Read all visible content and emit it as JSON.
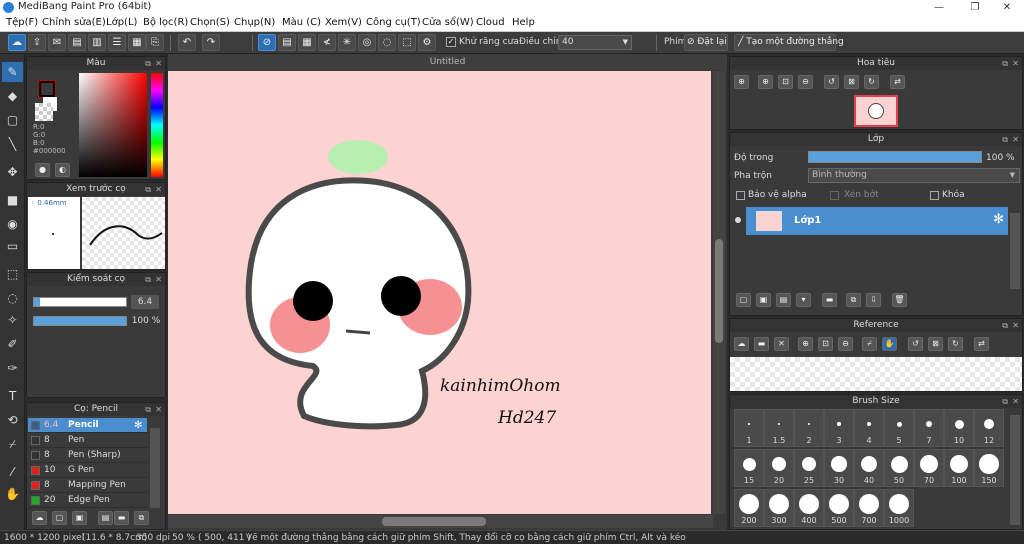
{
  "app": {
    "title": "MediBang Paint Pro (64bit)"
  },
  "menu": [
    "Tệp(F)",
    "Chỉnh sửa(E)",
    "Lớp(L)",
    "Bộ lọc(R)",
    "Chọn(S)",
    "Chụp(N)",
    "Màu (C)",
    "Xem(V)",
    "Công cụ(T)",
    "Cửa sổ(W)",
    "Cloud",
    "Help"
  ],
  "toolbar": {
    "antialias_label": "Khử răng cưa",
    "adjust_label": "Điều chỉnh",
    "adjust_value": "40",
    "pen_label": "Phím",
    "reset_label": "Đặt lại",
    "ruler_label": "Tạo một đường thẳng"
  },
  "color_panel": {
    "title": "Màu",
    "r": "R:0",
    "g": "G:0",
    "b": "B:0",
    "hex": "#000000",
    "fg": "#cc0000",
    "bg": "#ffffff"
  },
  "preview_panel": {
    "title": "Xem trước cọ",
    "size": "0.46mm"
  },
  "brush_control": {
    "title": "Kiểm soát cọ",
    "size_value": "6.4",
    "opacity_value": "100 %",
    "size_fraction": 0.07,
    "opacity_fraction": 1.0
  },
  "brush_panel": {
    "title": "Cọ: Pencil",
    "items": [
      {
        "size": "6.4",
        "name": "Pencil",
        "color": "#3a5f8a"
      },
      {
        "size": "8",
        "name": "Pen",
        "color": "#333333"
      },
      {
        "size": "8",
        "name": "Pen (Sharp)",
        "color": "#333333"
      },
      {
        "size": "10",
        "name": "G Pen",
        "color": "#dd2222"
      },
      {
        "size": "8",
        "name": "Mapping Pen",
        "color": "#dd2222"
      },
      {
        "size": "20",
        "name": "Edge Pen",
        "color": "#22aa22"
      }
    ]
  },
  "canvas": {
    "tab": "Untitled",
    "bg": "#fdd3d1",
    "signature_line1": "kainhimOhom",
    "signature_line2": "Hd247"
  },
  "navigator": {
    "title": "Hoa tiêu"
  },
  "layer_panel": {
    "title": "Lớp",
    "opacity_label": "Độ trong",
    "opacity_value": "100 %",
    "opacity_fraction": 1.0,
    "blend_label": "Pha trộn",
    "blend_value": "Bình thường",
    "protect_alpha": "Bảo vệ alpha",
    "clipping": "Xén bớt",
    "lock": "Khóa",
    "layer_name": "Lớp1"
  },
  "reference": {
    "title": "Reference"
  },
  "brush_size": {
    "title": "Brush Size",
    "sizes": [
      "1",
      "1.5",
      "2",
      "3",
      "4",
      "5",
      "7",
      "10",
      "12",
      "15",
      "20",
      "25",
      "30",
      "40",
      "50",
      "70",
      "100",
      "150",
      "200",
      "300",
      "400",
      "500",
      "700",
      "1000"
    ]
  },
  "status": {
    "dims": "1600 * 1200 pixel",
    "cm": "(11.6 * 8.7cm)",
    "dpi": "350 dpi",
    "zoom": "50 %",
    "coords": "( 500, 411 )",
    "hint": "Vẽ một đường thẳng bằng cách giữ phím Shift, Thay đổi cỡ cọ bằng cách giữ phím Ctrl, Alt và kéo"
  }
}
